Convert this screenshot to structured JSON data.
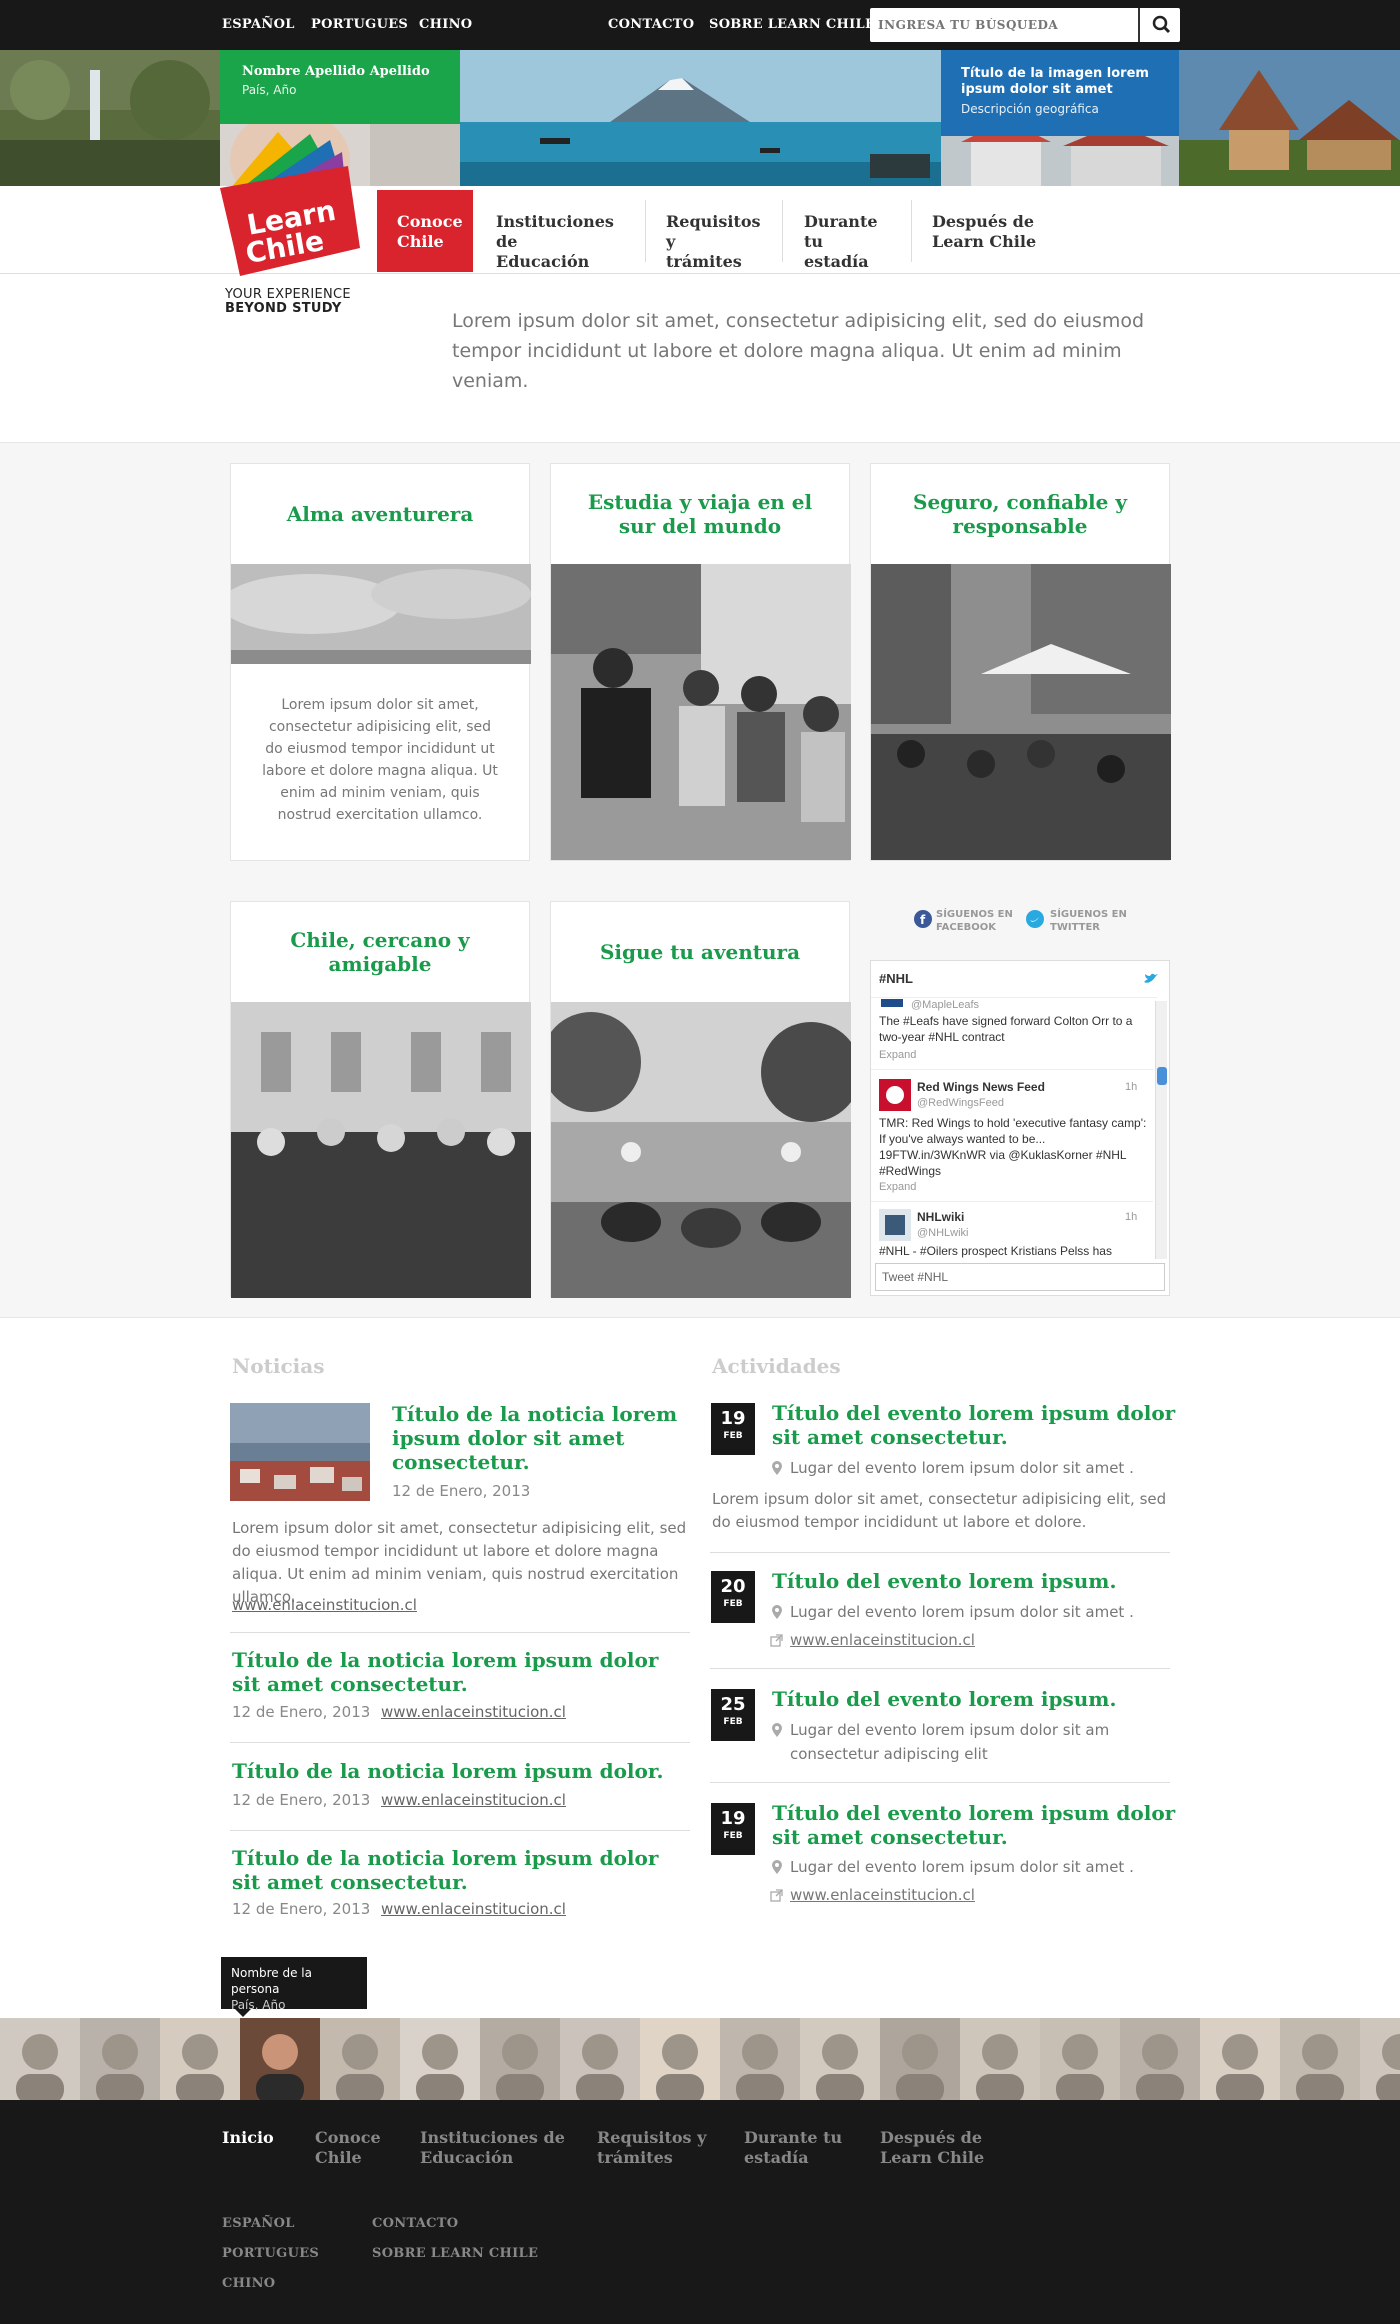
{
  "topbar": {
    "languages": [
      "ESPAÑOL",
      "PORTUGUES",
      "CHINO"
    ],
    "links": [
      "CONTACTO",
      "SOBRE LEARN CHILE"
    ],
    "search_placeholder": "INGRESA TU BÚSQUEDA"
  },
  "banner": {
    "green_card": {
      "name": "Nombre Apellido Apellido",
      "sub": "País, Año"
    },
    "blue_card": {
      "title": "Título de la imagen lorem ipsum dolor sit amet",
      "sub": "Descripción geográfica"
    }
  },
  "logo": {
    "line1": "Learn",
    "line2": "Chile",
    "tagline1": "YOUR EXPERIENCE",
    "tagline2": "BEYOND STUDY"
  },
  "nav": [
    {
      "l1": "Conoce",
      "l2": "Chile",
      "active": true
    },
    {
      "l1": "Instituciones de",
      "l2": "Educación"
    },
    {
      "l1": "Requisitos y",
      "l2": "trámites"
    },
    {
      "l1": "Durante tu",
      "l2": "estadía"
    },
    {
      "l1": "Después de",
      "l2": "Learn Chile"
    }
  ],
  "intro": "Lorem ipsum dolor sit amet, consectetur adipisicing elit, sed do eiusmod tempor incididunt ut labore et dolore magna aliqua. Ut enim ad minim veniam.",
  "tiles": [
    {
      "title": "Alma aventurera",
      "text": "Lorem ipsum dolor sit amet, consectetur adipisicing elit, sed do eiusmod tempor incididunt ut labore et dolore magna aliqua. Ut enim ad minim veniam, quis nostrud exercitation ullamco."
    },
    {
      "title": "Estudia y viaja en el sur del mundo"
    },
    {
      "title": "Seguro, confiable y responsable"
    },
    {
      "title": "Chile, cercano y amigable"
    },
    {
      "title": "Sigue tu aventura"
    }
  ],
  "social": {
    "facebook": "SÍGUENOS EN FACEBOOK",
    "twitter": "SÍGUENOS EN TWITTER"
  },
  "twitter": {
    "hashtag": "#NHL",
    "t1_handle": "@MapleLeafs",
    "t1_text": "The #Leafs have signed forward Colton Orr to a two-year #NHL contract",
    "expand": "Expand",
    "t2_name": "Red Wings News Feed",
    "t2_handle": "@RedWingsFeed",
    "t2_time": "1h",
    "t2_text": "TMR: Red Wings to hold 'executive fantasy camp': If you've always wanted to be... 19FTW.in/3WKnWR via @KuklasKorner #NHL #RedWings",
    "t3_name": "NHLwiki",
    "t3_handle": "@NHLwiki",
    "t3_time": "1h",
    "t3_text": "#NHL - #Oilers prospect Kristians Pelss has",
    "compose": "Tweet #NHL"
  },
  "news": {
    "heading": "Noticias",
    "items": [
      {
        "title": "Título de la noticia lorem ipsum dolor sit amet consectetur.",
        "date": "12 de Enero, 2013",
        "text": "Lorem ipsum dolor sit amet, consectetur adipisicing elit, sed do eiusmod tempor incididunt ut labore et dolore magna aliqua. Ut enim ad minim veniam, quis nostrud exercitation ullamco.",
        "link": "www.enlaceinstitucion.cl"
      },
      {
        "title": "Título de la noticia lorem ipsum dolor sit amet consectetur.",
        "date": "12 de Enero, 2013",
        "link": "www.enlaceinstitucion.cl"
      },
      {
        "title": "Título de la noticia lorem ipsum dolor.",
        "date": "12 de Enero, 2013",
        "link": "www.enlaceinstitucion.cl"
      },
      {
        "title": "Título de la noticia lorem ipsum dolor sit amet consectetur.",
        "date": "12 de Enero, 2013",
        "link": "www.enlaceinstitucion.cl"
      }
    ]
  },
  "events": {
    "heading": "Actividades",
    "items": [
      {
        "day": "19",
        "month": "FEB",
        "title": "Título del evento lorem ipsum dolor sit amet consectetur.",
        "place": "Lugar del evento lorem ipsum dolor sit amet .",
        "text": "Lorem ipsum dolor sit amet, consectetur adipisicing elit, sed do eiusmod tempor incididunt ut labore et dolore."
      },
      {
        "day": "20",
        "month": "FEB",
        "title": "Título del evento lorem ipsum.",
        "place": "Lugar del evento lorem ipsum dolor sit amet .",
        "link": "www.enlaceinstitucion.cl"
      },
      {
        "day": "25",
        "month": "FEB",
        "title": "Título del evento lorem ipsum.",
        "place": "Lugar del evento lorem ipsum dolor sit am consectetur adipiscing elit"
      },
      {
        "day": "19",
        "month": "FEB",
        "title": "Título del evento lorem ipsum dolor sit amet consectetur.",
        "place": "Lugar del evento lorem ipsum dolor sit amet .",
        "link": "www.enlaceinstitucion.cl"
      }
    ]
  },
  "tooltip": {
    "name": "Nombre de la persona",
    "sub": "País, Año"
  },
  "footer": {
    "nav": [
      {
        "l1": "Inicio",
        "l2": ""
      },
      {
        "l1": "Conoce",
        "l2": "Chile"
      },
      {
        "l1": "Instituciones de",
        "l2": "Educación"
      },
      {
        "l1": "Requisitos y",
        "l2": "trámites"
      },
      {
        "l1": "Durante tu",
        "l2": "estadía"
      },
      {
        "l1": "Después de",
        "l2": "Learn Chile"
      }
    ],
    "languages": [
      "ESPAÑOL",
      "PORTUGUES",
      "CHINO"
    ],
    "links": [
      "CONTACTO",
      "SOBRE LEARN CHILE"
    ]
  },
  "colors": {
    "brand_green": "#1a9a4b",
    "brand_red": "#d9232d",
    "dark": "#181818",
    "blue": "#1f6fb5"
  }
}
